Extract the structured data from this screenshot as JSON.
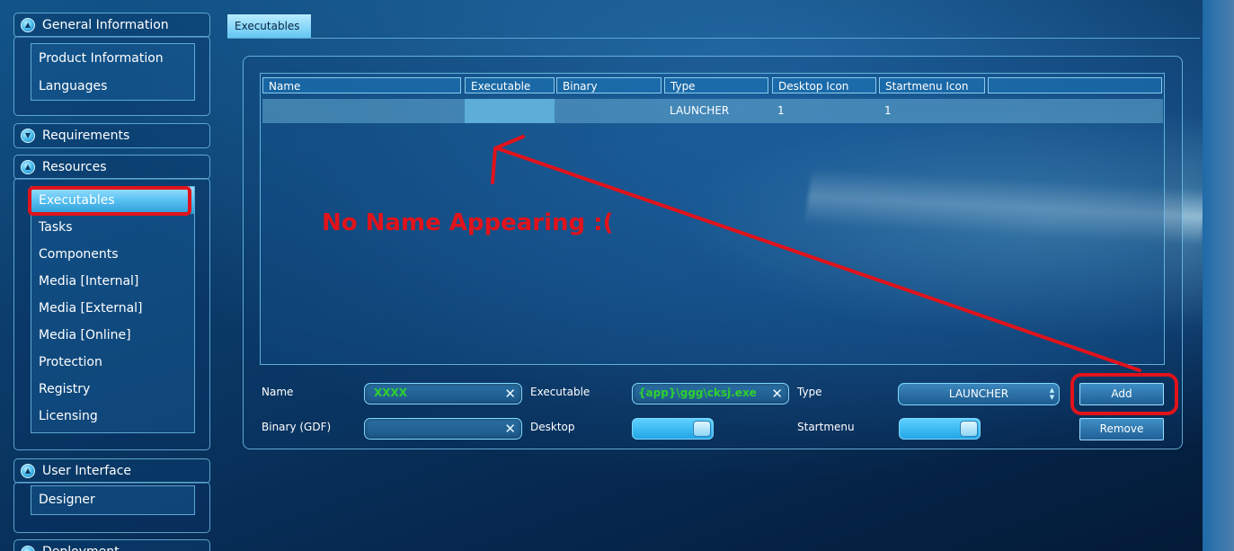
{
  "sidebar": {
    "groups": [
      {
        "label": "General Information",
        "items": [
          "Product Information",
          "Languages"
        ]
      },
      {
        "label": "Requirements"
      },
      {
        "label": "Resources",
        "items": [
          "Executables",
          "Tasks",
          "Components",
          "Media [Internal]",
          "Media [External]",
          "Media [Online]",
          "Protection",
          "Registry",
          "Licensing"
        ],
        "selected": "Executables"
      },
      {
        "label": "User Interface",
        "items": [
          "Designer"
        ]
      },
      {
        "label": "Deployment"
      }
    ]
  },
  "main": {
    "tab_label": "Executables",
    "table": {
      "columns": [
        "Name",
        "Executable",
        "Binary",
        "Type",
        "Desktop Icon",
        "Startmenu Icon",
        ""
      ],
      "rows": [
        [
          "",
          "",
          "",
          "LAUNCHER",
          "1",
          "1",
          ""
        ]
      ]
    },
    "form": {
      "name_label": "Name",
      "name_value": "XXXX",
      "executable_label": "Executable",
      "executable_value": "{app}\\ggg\\cksj.exe",
      "type_label": "Type",
      "type_value": "LAUNCHER",
      "binary_label": "Binary (GDF)",
      "binary_value": "",
      "desktop_label": "Desktop",
      "desktop_on": true,
      "startmenu_label": "Startmenu",
      "startmenu_on": true,
      "add_label": "Add",
      "remove_label": "Remove"
    },
    "annotation": "No Name Appearing :("
  },
  "colors": {
    "annotation": "#e0131b",
    "accent": "#57c1f2",
    "input_text": "#2fd02f"
  }
}
